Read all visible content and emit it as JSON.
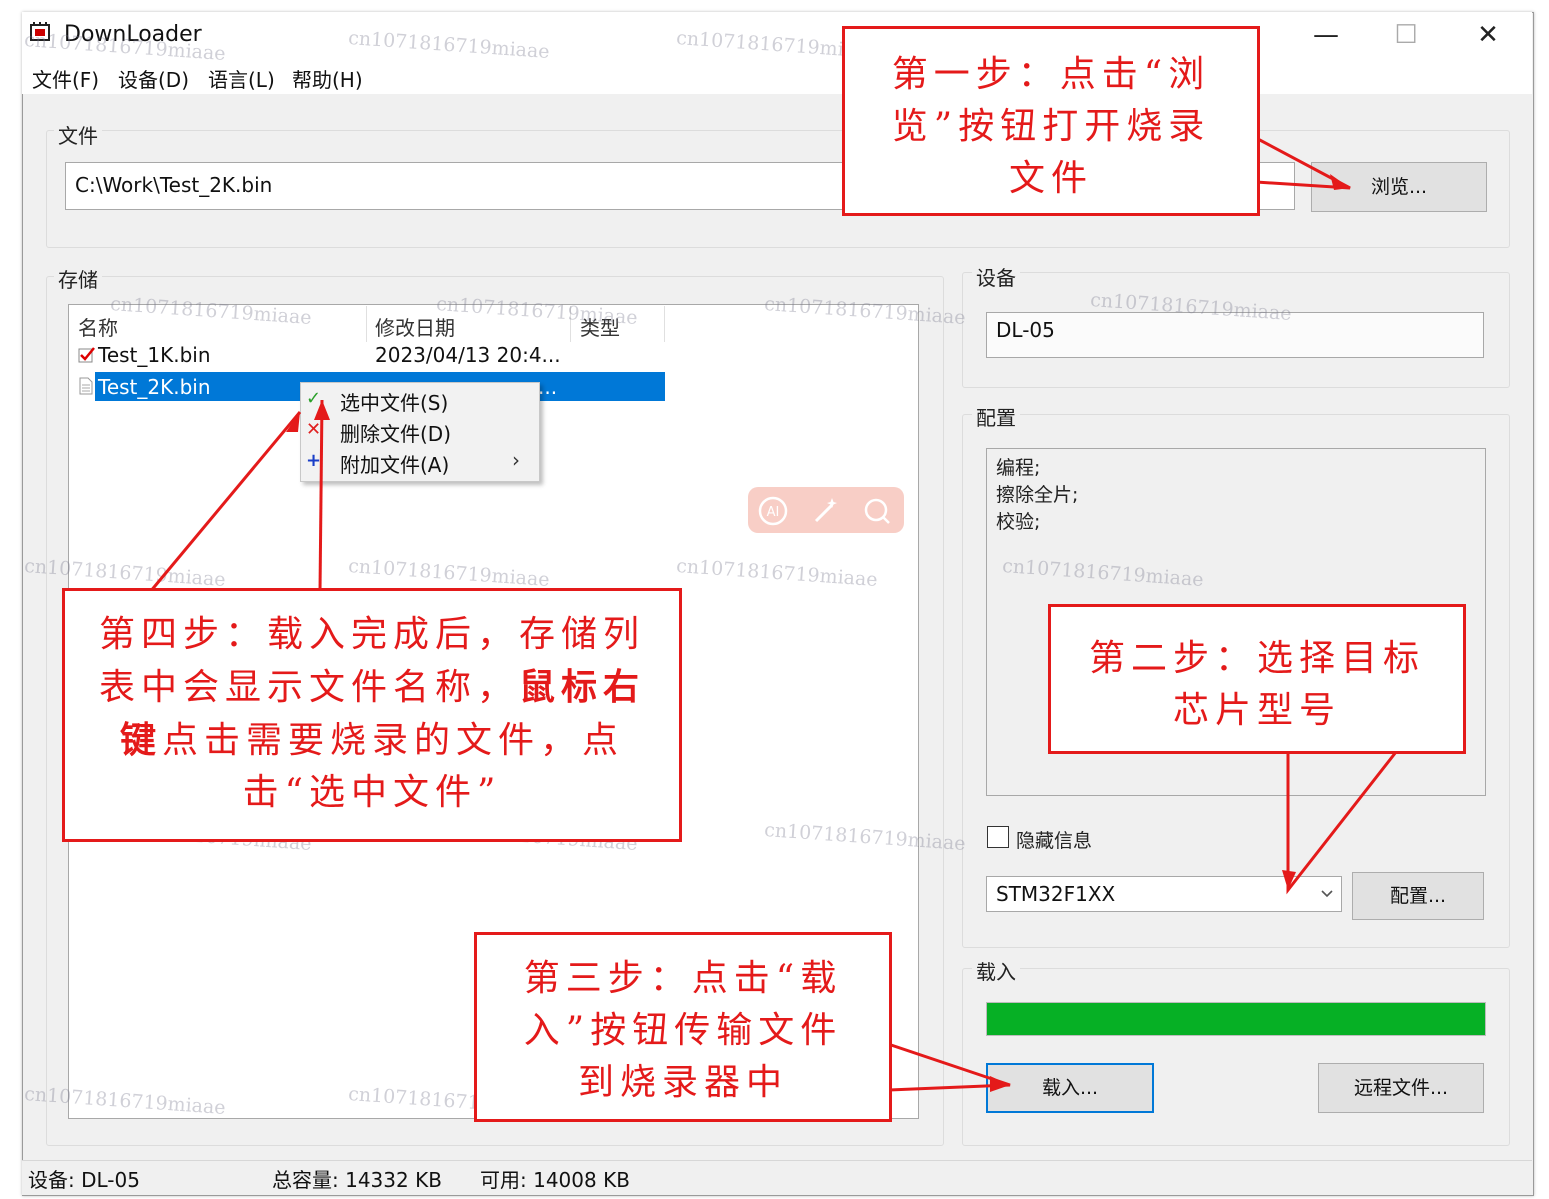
{
  "window": {
    "title": "DownLoader",
    "controls": {
      "minimize": "—",
      "maximize": "☐",
      "close": "✕"
    }
  },
  "menu": [
    "文件(F)",
    "设备(D)",
    "语言(L)",
    "帮助(H)"
  ],
  "file_group": {
    "label": "文件",
    "path": "C:\\Work\\Test_2K.bin",
    "browse_button": "浏览..."
  },
  "storage_group": {
    "label": "存储",
    "columns": [
      "名称",
      "修改日期",
      "类型"
    ],
    "rows": [
      {
        "name": "Test_1K.bin",
        "date": "2023/04/13 20:4...",
        "selected": false
      },
      {
        "name": "Test_2K.bin",
        "date": "...",
        "selected": true
      }
    ]
  },
  "context_menu": {
    "items": [
      {
        "label": "选中文件(S)",
        "icon": "✓"
      },
      {
        "label": "删除文件(D)",
        "icon": "✕"
      },
      {
        "label": "附加文件(A)",
        "icon": "+",
        "submenu": "›"
      }
    ]
  },
  "device_group": {
    "label": "设备",
    "value": "DL-05"
  },
  "config_group": {
    "label": "配置",
    "lines": [
      "编程;",
      "擦除全片;",
      "校验;"
    ],
    "hide_info_label": "隐藏信息",
    "chip": "STM32F1XX",
    "config_button": "配置..."
  },
  "load_group": {
    "label": "载入",
    "progress": 1.0,
    "load_button": "载入...",
    "remote_button": "远程文件..."
  },
  "status_bar": {
    "device": "设备: DL-05",
    "capacity": "总容量:  14332 KB",
    "free": "可用:  14008 KB"
  },
  "callouts": {
    "step1": "第一步：点击“浏览”按钮打开烧录文件",
    "step2": "第二步：选择目标芯片型号",
    "step3": "第三步：点击“载入”按钮传输文件到烧录器中",
    "step4_normal_a": "第四步：载入完成后，存储列表中会显示文件名称，",
    "step4_bold_a": "鼠标右",
    "step4_bold_b": "键",
    "step4_normal_b": "点击需要烧录的文件，点击“选中文件”"
  },
  "watermark": "cn1071816719miaae",
  "colors": {
    "callout": "#e41a1a",
    "selection": "#0078d7",
    "progress": "#06b025"
  }
}
